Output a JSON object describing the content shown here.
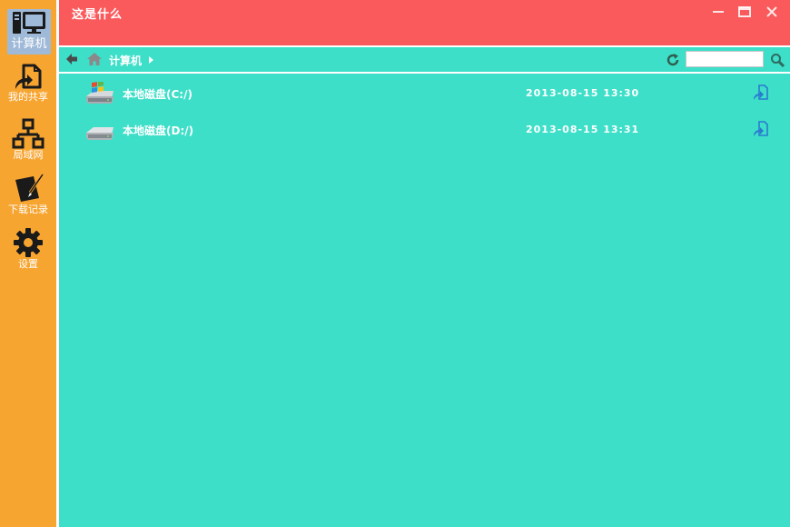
{
  "window": {
    "title": "这是什么",
    "controls": {
      "minimize_icon": "minimize-icon",
      "maximize_icon": "maximize-icon",
      "close_icon": "close-icon"
    }
  },
  "colors": {
    "sidebar_bg": "#f7a531",
    "titlebar_bg": "#fb5a5c",
    "content_bg": "#3ddfc8",
    "active_nav_bg": "#9fb9d8"
  },
  "sidebar": {
    "items": [
      {
        "label": "计算机",
        "icon": "computer-icon",
        "active": true
      },
      {
        "label": "我的共享",
        "icon": "shared-file-icon",
        "active": false
      },
      {
        "label": "局域网",
        "icon": "network-icon",
        "active": false
      },
      {
        "label": "下载记录",
        "icon": "download-record-icon",
        "active": false
      },
      {
        "label": "设置",
        "icon": "gear-icon",
        "active": false
      }
    ]
  },
  "toolbar": {
    "breadcrumb": [
      "计算机"
    ],
    "search": {
      "value": "",
      "placeholder": ""
    }
  },
  "files": [
    {
      "name": "本地磁盘(C:/)",
      "date": "2013-08-15 13:30",
      "icon": "windows-drive-icon"
    },
    {
      "name": "本地磁盘(D:/)",
      "date": "2013-08-15 13:31",
      "icon": "drive-icon"
    }
  ]
}
